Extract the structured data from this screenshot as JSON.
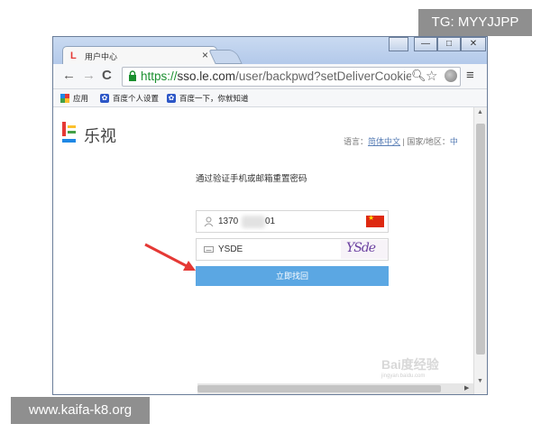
{
  "overlay": {
    "tg_label": "TG: MYYJJPP",
    "site_label": "www.kaifa-k8.org"
  },
  "browser": {
    "tab_title": "用户中心",
    "tab_close": "×",
    "window_buttons": {
      "user": "",
      "minimize": "—",
      "maximize": "□",
      "close": "✕"
    },
    "url_scheme": "https://",
    "url_host": "sso.le.com",
    "url_path": "/user/backpwd?setDeliverCookie=ht",
    "bookmarks": [
      {
        "label": "应用",
        "icon": "apps-grid-icon"
      },
      {
        "label": "百度个人设置",
        "icon": "baidu-paw-icon"
      },
      {
        "label": "百度一下，你就知道",
        "icon": "baidu-paw-icon"
      }
    ]
  },
  "page": {
    "logo_text": "乐视",
    "lang_prefix": "语言：",
    "lang_value": "简体中文",
    "lang_sep": "|",
    "region_prefix": "国家/地区：",
    "region_value": "中",
    "heading": "通过验证手机或邮箱重置密码",
    "phone_prefix": "1370",
    "phone_suffix": "01",
    "captcha_value": "YSDE",
    "captcha_image_text": "YSde",
    "submit_label": "立即找回",
    "watermark_main": "Bai度经验",
    "watermark_sub": "jingyan.baidu.com"
  },
  "colors": {
    "brand_red": "#e53935",
    "submit_blue": "#5ba7e3",
    "https_green": "#1a8f2e",
    "arrow_red": "#e53935"
  }
}
